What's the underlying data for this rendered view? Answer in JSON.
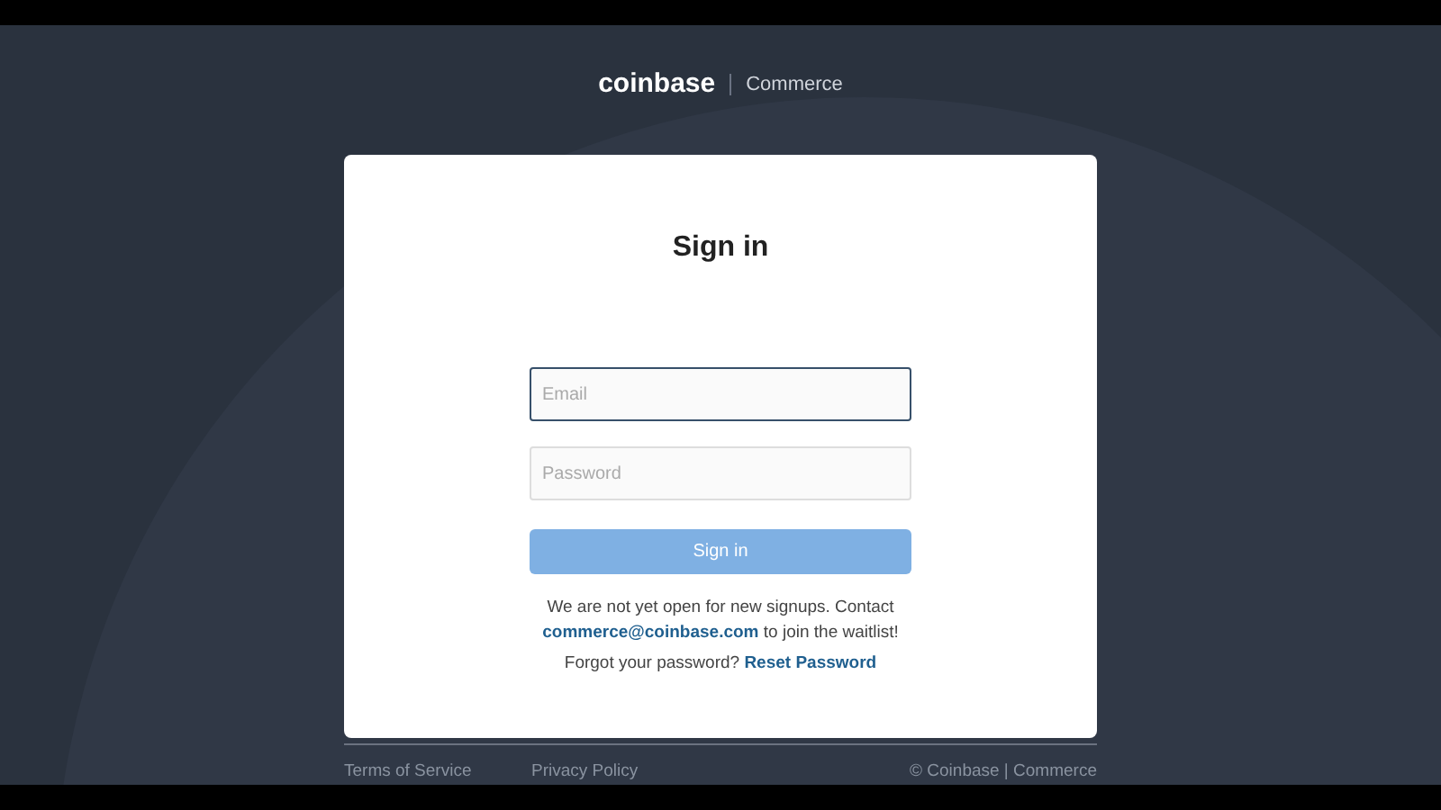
{
  "header": {
    "logo": "coinbase",
    "product": "Commerce"
  },
  "card": {
    "title": "Sign in",
    "fields": [
      {
        "placeholder": "Email",
        "focused": true
      },
      {
        "placeholder": "Password",
        "focused": false
      }
    ],
    "button": {
      "label": "Sign in",
      "disabled": true
    },
    "notice": {
      "text": "We are not yet open for new signups. Contact",
      "link": "commerce@coinbase.com",
      "after": "to join the waitlist!"
    },
    "forgot": {
      "text": "Forgot your password?",
      "link": "Reset Password"
    }
  },
  "footer": {
    "links": [
      "Terms of Service",
      "Privacy Policy"
    ],
    "copyright": "© Coinbase | Commerce"
  }
}
